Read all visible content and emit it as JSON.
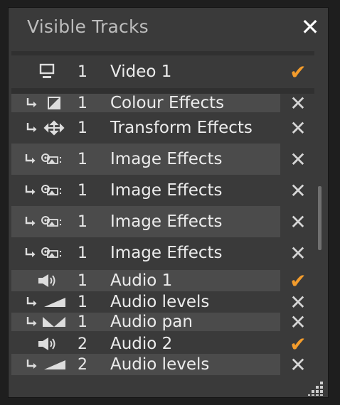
{
  "dialog": {
    "title": "Visible Tracks",
    "close_label": "✕"
  },
  "tracks": [
    {
      "icon": "monitor-icon",
      "number": "1",
      "name": "Video 1",
      "visible": true
    },
    {
      "icon": "colour-effects-icon",
      "number": "1",
      "name": "Colour Effects",
      "visible": false
    },
    {
      "icon": "transform-effects-icon",
      "number": "1",
      "name": "Transform Effects",
      "visible": false
    },
    {
      "icon": "image-effects-icon",
      "number": "1",
      "name": "Image Effects",
      "visible": false
    },
    {
      "icon": "image-effects-icon",
      "number": "1",
      "name": "Image Effects",
      "visible": false
    },
    {
      "icon": "image-effects-icon",
      "number": "1",
      "name": "Image Effects",
      "visible": false
    },
    {
      "icon": "image-effects-icon",
      "number": "1",
      "name": "Image Effects",
      "visible": false
    },
    {
      "icon": "speaker-icon",
      "number": "1",
      "name": "Audio 1",
      "visible": true
    },
    {
      "icon": "audio-levels-icon",
      "number": "1",
      "name": "Audio levels",
      "visible": false
    },
    {
      "icon": "audio-pan-icon",
      "number": "1",
      "name": "Audio pan",
      "visible": false
    },
    {
      "icon": "speaker-icon",
      "number": "2",
      "name": "Audio 2",
      "visible": true
    },
    {
      "icon": "audio-levels-icon",
      "number": "2",
      "name": "Audio levels",
      "visible": false
    }
  ],
  "symbols": {
    "visible": "✔",
    "hidden": "✕"
  },
  "colors": {
    "accent": "#f39c2c",
    "panel": "#3a3a3a",
    "row_alt": "#4b4b4b",
    "background": "#1e1e1e"
  }
}
